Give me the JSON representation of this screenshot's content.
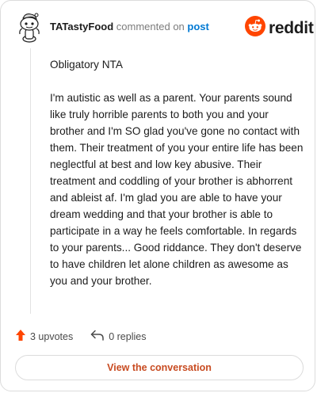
{
  "comment": {
    "username": "TATastyFood",
    "commented_text": "commented on",
    "post_link": "post",
    "paragraphs": [
      "Obligatory NTA",
      "I'm autistic as well as a parent. Your parents sound like truly horrible parents to both you and your brother and I'm SO glad you've gone no contact with them. Their treatment of you your entire life has been neglectful at best and low key abusive. Their treatment and coddling of your brother is abhorrent and ableist af. I'm glad you are able to have your dream wedding and that your brother is able to participate in a way he feels comfortable. In regards to your parents... Good riddance. They don't deserve to have children let alone children as awesome as you and your brother."
    ]
  },
  "brand": {
    "wordmark": "reddit",
    "icon": "reddit-alien-icon",
    "color": "#ff4500"
  },
  "actions": {
    "upvotes": "3 upvotes",
    "replies": "0 replies",
    "upvote_icon": "upvote-arrow-icon",
    "reply_icon": "reply-arrow-icon",
    "upvote_color": "#ff4500"
  },
  "view_button": {
    "label": "View the conversation",
    "color": "#c84b21"
  }
}
